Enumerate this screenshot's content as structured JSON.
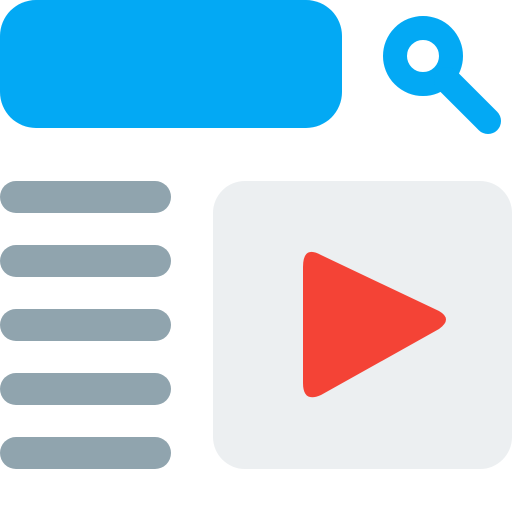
{
  "colors": {
    "search_bar": "#03a9f4",
    "search_icon": "#03a9f4",
    "menu_lines": "#90a4ae",
    "video_background": "#eceff1",
    "play_icon": "#f44336"
  },
  "search": {
    "bar_icon": "search-field",
    "button_icon": "magnifier-icon"
  },
  "menu": {
    "icon": "list-lines",
    "line_count": 5
  },
  "video": {
    "icon": "play-icon"
  }
}
